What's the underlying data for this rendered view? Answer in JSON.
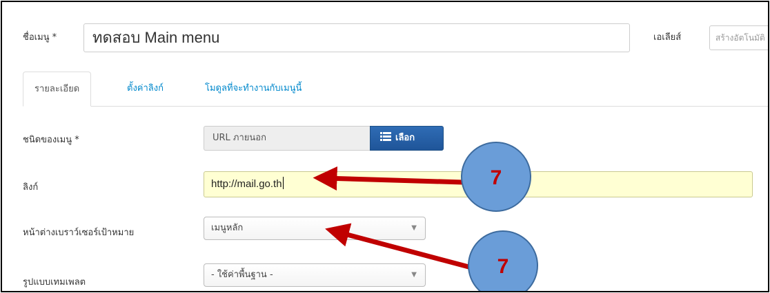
{
  "form": {
    "title_label": "ชื่อเมนู *",
    "title_value": "ทดสอบ Main menu",
    "alias_label": "เอเลียส์",
    "alias_placeholder": "สร้างอัตโนมัติ"
  },
  "tabs": [
    {
      "label": "รายละเอียด",
      "active": true
    },
    {
      "label": "ตั้งค่าลิงก์",
      "active": false
    },
    {
      "label": "โมดูลที่จะทำงานกับเมนูนี้",
      "active": false
    }
  ],
  "fields": {
    "menu_type": {
      "label": "ชนิดของเมนู *",
      "value": "URL ภายนอก",
      "button_label": "เลือก",
      "button_icon": "list-icon"
    },
    "link": {
      "label": "ลิงก์",
      "value": "http://mail.go.th"
    },
    "target_window": {
      "label": "หน้าต่างเบราว์เซอร์เป้าหมาย",
      "value": "เมนูหลัก"
    },
    "template_style": {
      "label": "รูปแบบเทมเพลต",
      "value": "- ใช้ค่าพื้นฐาน -"
    }
  },
  "annotations": [
    {
      "number": "7",
      "points_to": "link"
    },
    {
      "number": "7",
      "points_to": "target_window"
    }
  ],
  "colors": {
    "accent": "#08c",
    "button": "#2f6cb5",
    "highlight_field": "#ffffd3",
    "callout_fill": "#6a9dd8",
    "callout_text": "#c00000",
    "arrow": "#c00000"
  }
}
